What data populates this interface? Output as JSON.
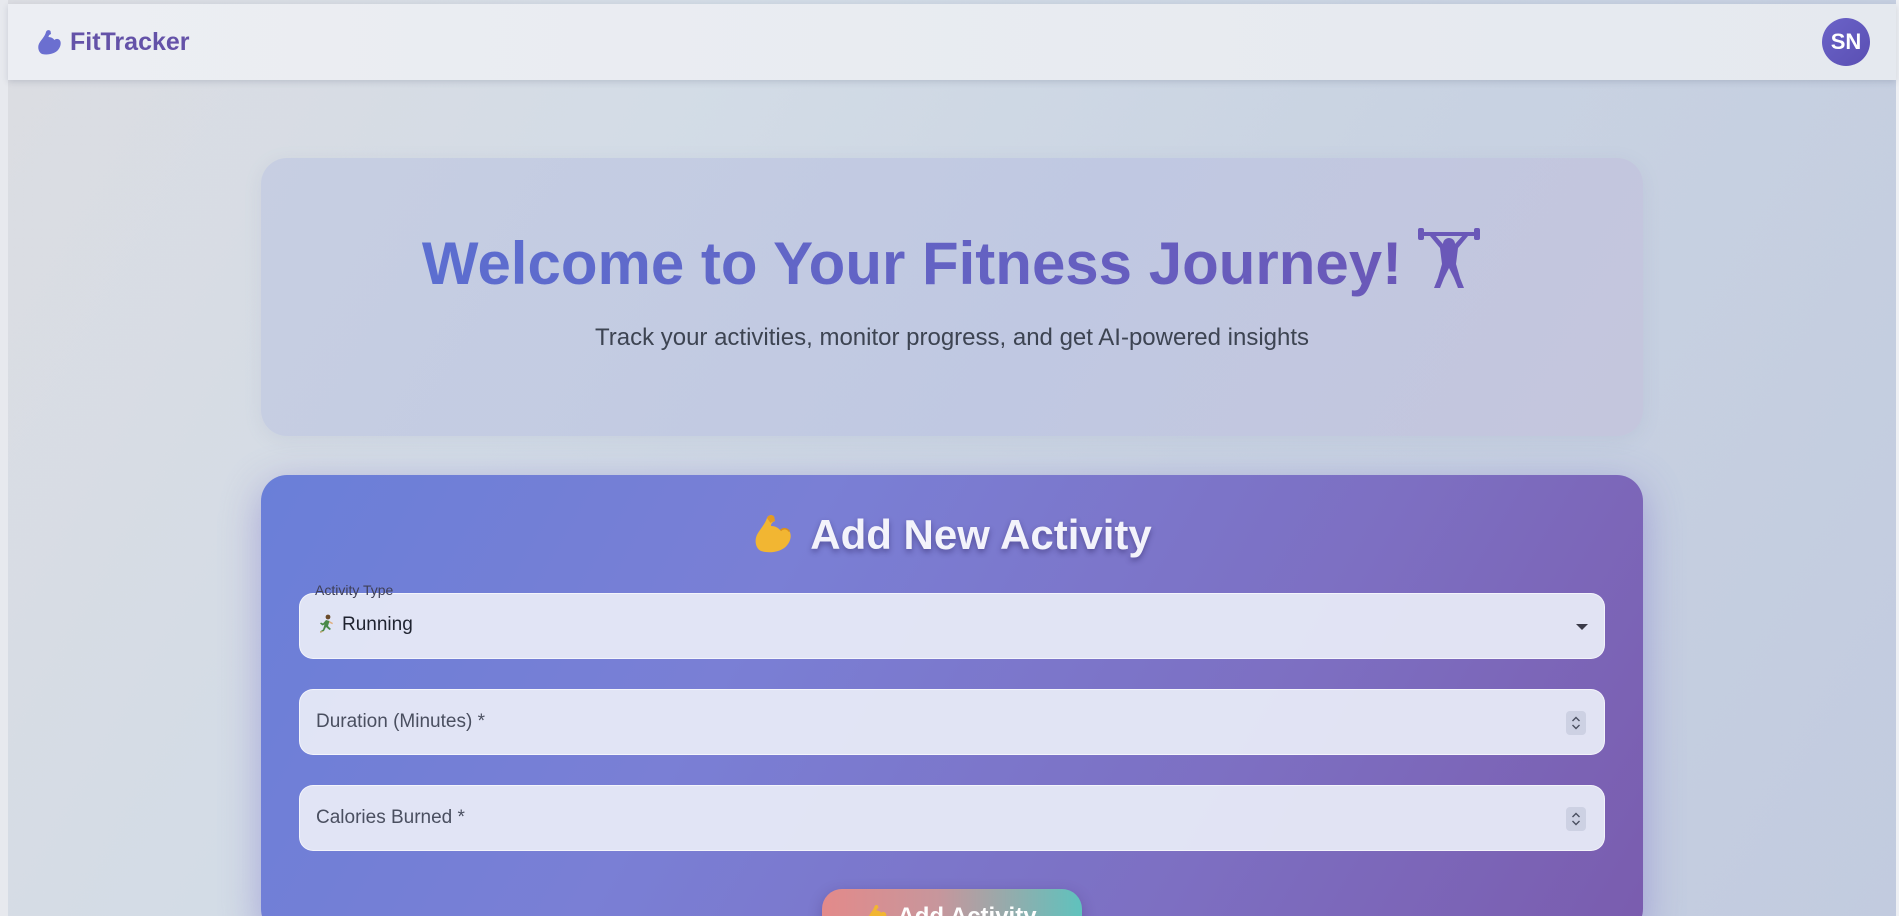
{
  "colors": {
    "brand": "#6452a8",
    "avatar_bg": "#5a4fb3",
    "title_gradient_start": "#5c6ed0",
    "title_gradient_end": "#6a58b8",
    "card_gradient_start": "#6a7fd8",
    "card_gradient_end": "#7a5cae",
    "button_gradient_start": "#e38a8a",
    "button_gradient_end": "#5fc2bd"
  },
  "header": {
    "brand_icon": "flexed-biceps-icon",
    "brand_name": "FitTracker",
    "avatar_initials": "SN"
  },
  "hero": {
    "title": "Welcome to Your Fitness Journey!",
    "title_icon": "weight-lifter-icon",
    "subtitle": "Track your activities, monitor progress, and get AI-powered insights"
  },
  "activity_form": {
    "title": "Add New Activity",
    "title_icon": "flexed-biceps-icon",
    "activity_type": {
      "label": "Activity Type",
      "selected_value": "Running",
      "selected_icon": "person-running-icon"
    },
    "duration": {
      "placeholder": "Duration (Minutes)",
      "required_mark": "*",
      "value": ""
    },
    "calories": {
      "placeholder": "Calories Burned",
      "required_mark": "*",
      "value": ""
    },
    "submit": {
      "label": "Add Activity",
      "icon": "flexed-biceps-icon"
    }
  }
}
